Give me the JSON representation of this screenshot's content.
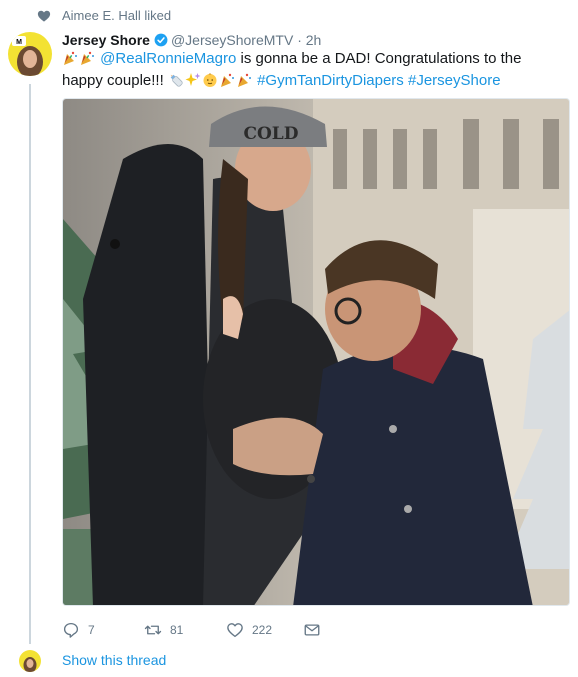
{
  "social_context": {
    "text": "Aimee E. Hall liked",
    "icon": "heart-icon"
  },
  "tweet": {
    "display_name": "Jersey Shore",
    "handle": "@JerseyShoreMTV",
    "separator": "·",
    "time": "2h",
    "text": {
      "mention": "@RealRonnieMagro",
      "body_1": " is gonna be a DAD! Congratulations to the happy couple!!! ",
      "hashtag_1": "#GymTanDirtyDiapers",
      "space": " ",
      "hashtag_2": "#JerseyShore"
    },
    "leading_emojis": [
      "party-popper",
      "party-popper"
    ],
    "trailing_emojis": [
      "baby-bottle",
      "sparkles",
      "baby",
      "party-popper",
      "party-popper"
    ],
    "image_text": {
      "hat": "COLD"
    },
    "actions": {
      "replies": "7",
      "retweets": "81",
      "likes": "222"
    }
  },
  "thread_link": {
    "label": "Show this thread"
  },
  "colors": {
    "link": "#1b95e0",
    "muted": "#657786",
    "thread_line": "#ccd6dd",
    "verified": "#1da1f2"
  }
}
